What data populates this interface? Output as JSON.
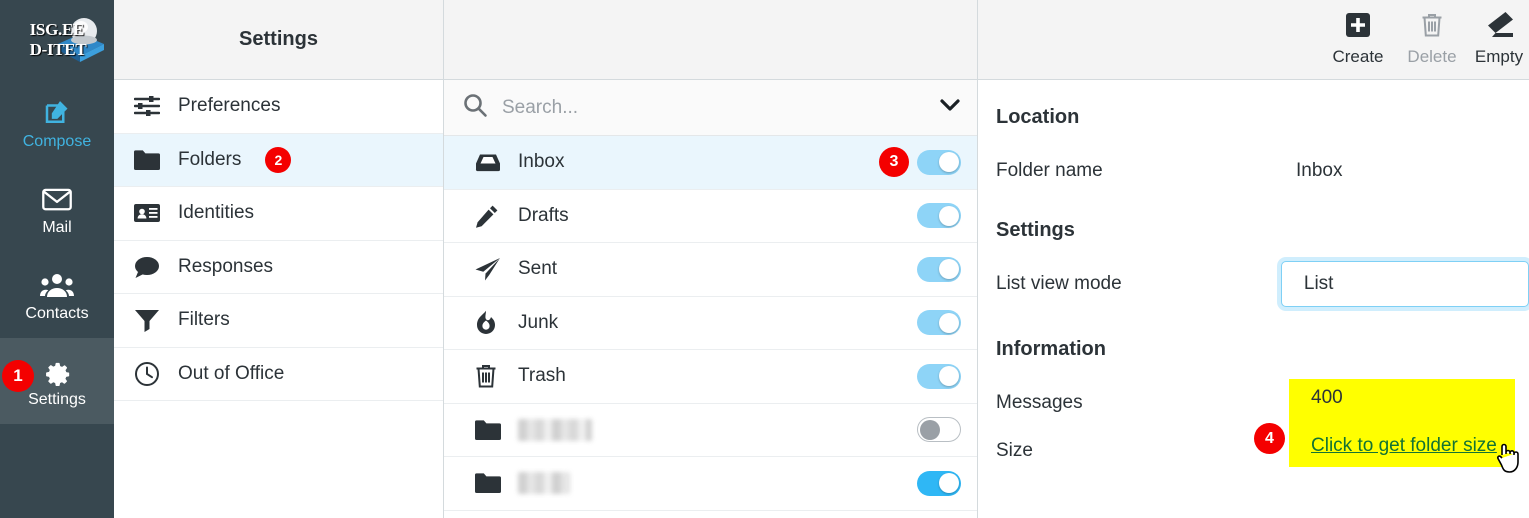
{
  "brand": {
    "line1": "ISG.EE",
    "line2": "D-ITET",
    "logo_icon": "isg-cube-logo"
  },
  "taskbar": {
    "items": [
      {
        "label": "Compose",
        "icon": "compose-pencil-icon",
        "badge": null,
        "active": false
      },
      {
        "label": "Mail",
        "icon": "envelope-icon",
        "badge": null,
        "active": false
      },
      {
        "label": "Contacts",
        "icon": "people-icon",
        "badge": null,
        "active": false
      },
      {
        "label": "Settings",
        "icon": "gear-icon",
        "badge": "1",
        "active": true
      }
    ]
  },
  "settings_list": {
    "header": "Settings",
    "items": [
      {
        "label": "Preferences",
        "icon": "sliders-icon",
        "badge": null,
        "selected": false
      },
      {
        "label": "Folders",
        "icon": "folder-icon",
        "badge": "2",
        "selected": true
      },
      {
        "label": "Identities",
        "icon": "id-card-icon",
        "badge": null,
        "selected": false
      },
      {
        "label": "Responses",
        "icon": "speech-bubble-icon",
        "badge": null,
        "selected": false
      },
      {
        "label": "Filters",
        "icon": "funnel-icon",
        "badge": null,
        "selected": false
      },
      {
        "label": "Out of Office",
        "icon": "clock-icon",
        "badge": null,
        "selected": false
      }
    ]
  },
  "folders_pane": {
    "search": {
      "placeholder": "Search...",
      "value": "",
      "search_icon": "search-icon",
      "expand_icon": "chevron-down-icon"
    },
    "rows": [
      {
        "name": "Inbox",
        "icon": "inbox-icon",
        "redacted": false,
        "selected": true,
        "toggle": "on",
        "badge": "3"
      },
      {
        "name": "Drafts",
        "icon": "pencil-icon",
        "redacted": false,
        "selected": false,
        "toggle": "on",
        "badge": null
      },
      {
        "name": "Sent",
        "icon": "paper-plane-icon",
        "redacted": false,
        "selected": false,
        "toggle": "on",
        "badge": null
      },
      {
        "name": "Junk",
        "icon": "flame-icon",
        "redacted": false,
        "selected": false,
        "toggle": "on",
        "badge": null
      },
      {
        "name": "Trash",
        "icon": "trash-icon",
        "redacted": false,
        "selected": false,
        "toggle": "on",
        "badge": null
      },
      {
        "name": "",
        "icon": "folder-icon",
        "redacted": true,
        "redact_width": 72,
        "selected": false,
        "toggle": "off",
        "badge": null
      },
      {
        "name": "",
        "icon": "folder-icon",
        "redacted": true,
        "redact_width": 50,
        "selected": false,
        "toggle": "on-strong",
        "badge": null
      }
    ]
  },
  "detail_pane": {
    "toolbar": [
      {
        "label": "Create",
        "icon": "plus-square-icon",
        "disabled": false
      },
      {
        "label": "Delete",
        "icon": "trash-icon",
        "disabled": true
      },
      {
        "label": "Empty",
        "icon": "eraser-icon",
        "disabled": false
      }
    ],
    "location": {
      "title": "Location",
      "folder_name_label": "Folder name",
      "folder_name_value": "Inbox"
    },
    "settings": {
      "title": "Settings",
      "list_view_mode_label": "List view mode",
      "list_view_mode_value": "List"
    },
    "information": {
      "title": "Information",
      "messages_label": "Messages",
      "messages_value": "400",
      "size_label": "Size",
      "size_link": "Click to get folder size"
    }
  },
  "callouts": [
    {
      "number": "1"
    },
    {
      "number": "2"
    },
    {
      "number": "3"
    },
    {
      "number": "4"
    }
  ],
  "colors": {
    "accent": "#2fb7f5",
    "badge_red": "#f40000",
    "taskbar_bg": "#37474f",
    "selected_row": "#eaf6fd",
    "highlight_yellow": "#ffff00",
    "link_green": "#137333"
  }
}
